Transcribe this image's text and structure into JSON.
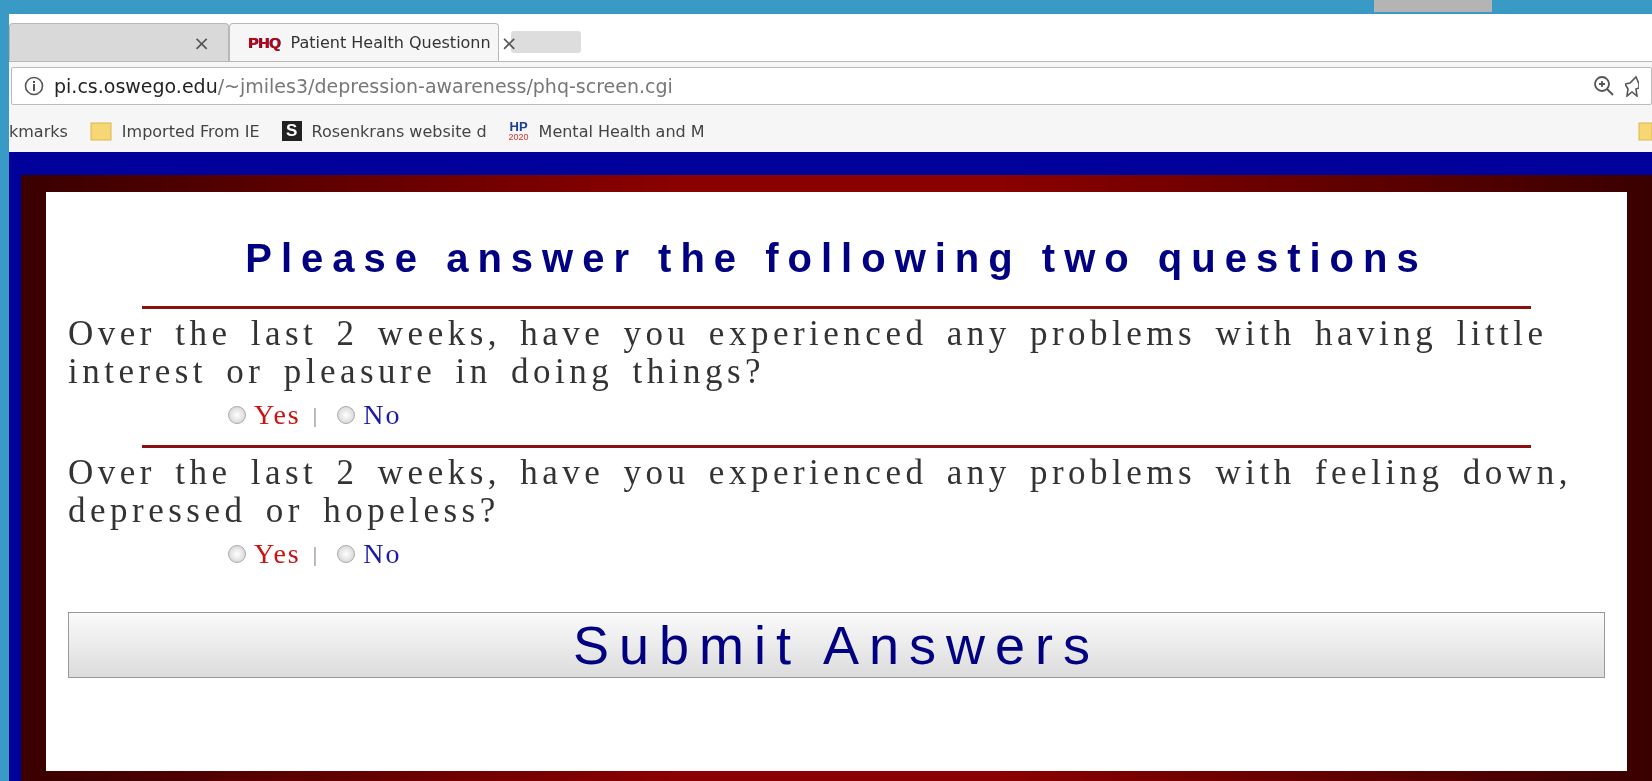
{
  "browser": {
    "tabs": [
      {
        "selected": false,
        "close": "×"
      },
      {
        "selected": true,
        "favicon": "PHQ",
        "title": "Patient Health Questionn",
        "close": "×"
      }
    ],
    "address": {
      "host": "pi.cs.oswego.edu",
      "path": "/~jmiles3/depression-awareness/phq-screen.cgi"
    },
    "bookmarks": [
      {
        "kind": "plain",
        "label": "kmarks"
      },
      {
        "kind": "folder",
        "label": "Imported From IE"
      },
      {
        "kind": "letter",
        "icon_text": "S",
        "label": "Rosenkrans website d"
      },
      {
        "kind": "logo",
        "icon_text": "HP",
        "icon_sub": "2020",
        "label": "Mental Health and M"
      }
    ]
  },
  "page": {
    "heading": "Please answer the following two questions",
    "questions": [
      {
        "text": "Over the last 2 weeks, have you experienced any problems with having little interest or pleasure in doing things?",
        "separator": "|",
        "options": [
          {
            "label": "Yes",
            "selected": false,
            "color": "#cc1111"
          },
          {
            "label": "No",
            "selected": false,
            "color": "#1a1aa6"
          }
        ]
      },
      {
        "text": "Over the last 2 weeks, have you experienced any problems with feeling down, depressed or hopeless?",
        "separator": "|",
        "options": [
          {
            "label": "Yes",
            "selected": false,
            "color": "#cc1111"
          },
          {
            "label": "No",
            "selected": false,
            "color": "#1a1aa6"
          }
        ]
      }
    ],
    "submit": "Submit Answers"
  }
}
